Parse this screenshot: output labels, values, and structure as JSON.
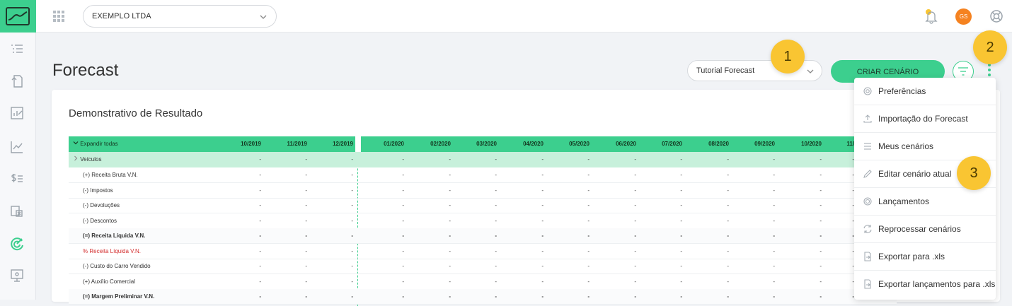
{
  "topbar": {
    "company": "EXEMPLO LTDA",
    "avatar_initials": "GS"
  },
  "page": {
    "title": "Forecast",
    "scenario": "Tutorial Forecast",
    "create_label": "CRIAR CENÁRIO"
  },
  "badges": [
    "1",
    "2",
    "3"
  ],
  "card": {
    "title": "Demonstrativo de Resultado"
  },
  "table": {
    "expand_label": "Expandir todas",
    "columns": [
      "10/2019",
      "11/2019",
      "12/2019",
      "01/2020",
      "02/2020",
      "03/2020",
      "04/2020",
      "05/2020",
      "06/2020",
      "07/2020",
      "08/2020",
      "09/2020",
      "10/2020",
      "11/"
    ],
    "group_label": "Veículos",
    "rows": [
      {
        "label": "(+) Receita Bruta V.N.",
        "style": "normal"
      },
      {
        "label": "(-) Impostos",
        "style": "normal"
      },
      {
        "label": "(-) Devoluções",
        "style": "normal"
      },
      {
        "label": "(-) Descontos",
        "style": "normal"
      },
      {
        "label": "(=) Receita Líquida V.N.",
        "style": "bold"
      },
      {
        "label": "% Receita Líquida V.N.",
        "style": "red"
      },
      {
        "label": "(-) Custo do Carro Vendido",
        "style": "normal"
      },
      {
        "label": "(+) Auxílio Comercial",
        "style": "normal"
      },
      {
        "label": "(=) Margem Preliminar V.N.",
        "style": "bold"
      }
    ],
    "empty_value": "-"
  },
  "menu": {
    "items": [
      {
        "label": "Preferências",
        "icon": "gear-icon"
      },
      {
        "label": "Importação do Forecast",
        "icon": "upload-icon"
      },
      {
        "label": "Meus cenários",
        "icon": "list-icon"
      },
      {
        "label": "Editar cenário atual",
        "icon": "pencil-icon"
      },
      {
        "label": "Lançamentos",
        "icon": "target-icon"
      },
      {
        "label": "Reprocessar cenários",
        "icon": "refresh-icon"
      },
      {
        "label": "Exportar para .xls",
        "icon": "file-export-icon"
      },
      {
        "label": "Exportar lançamentos para .xls",
        "icon": "file-export-icon"
      }
    ]
  }
}
